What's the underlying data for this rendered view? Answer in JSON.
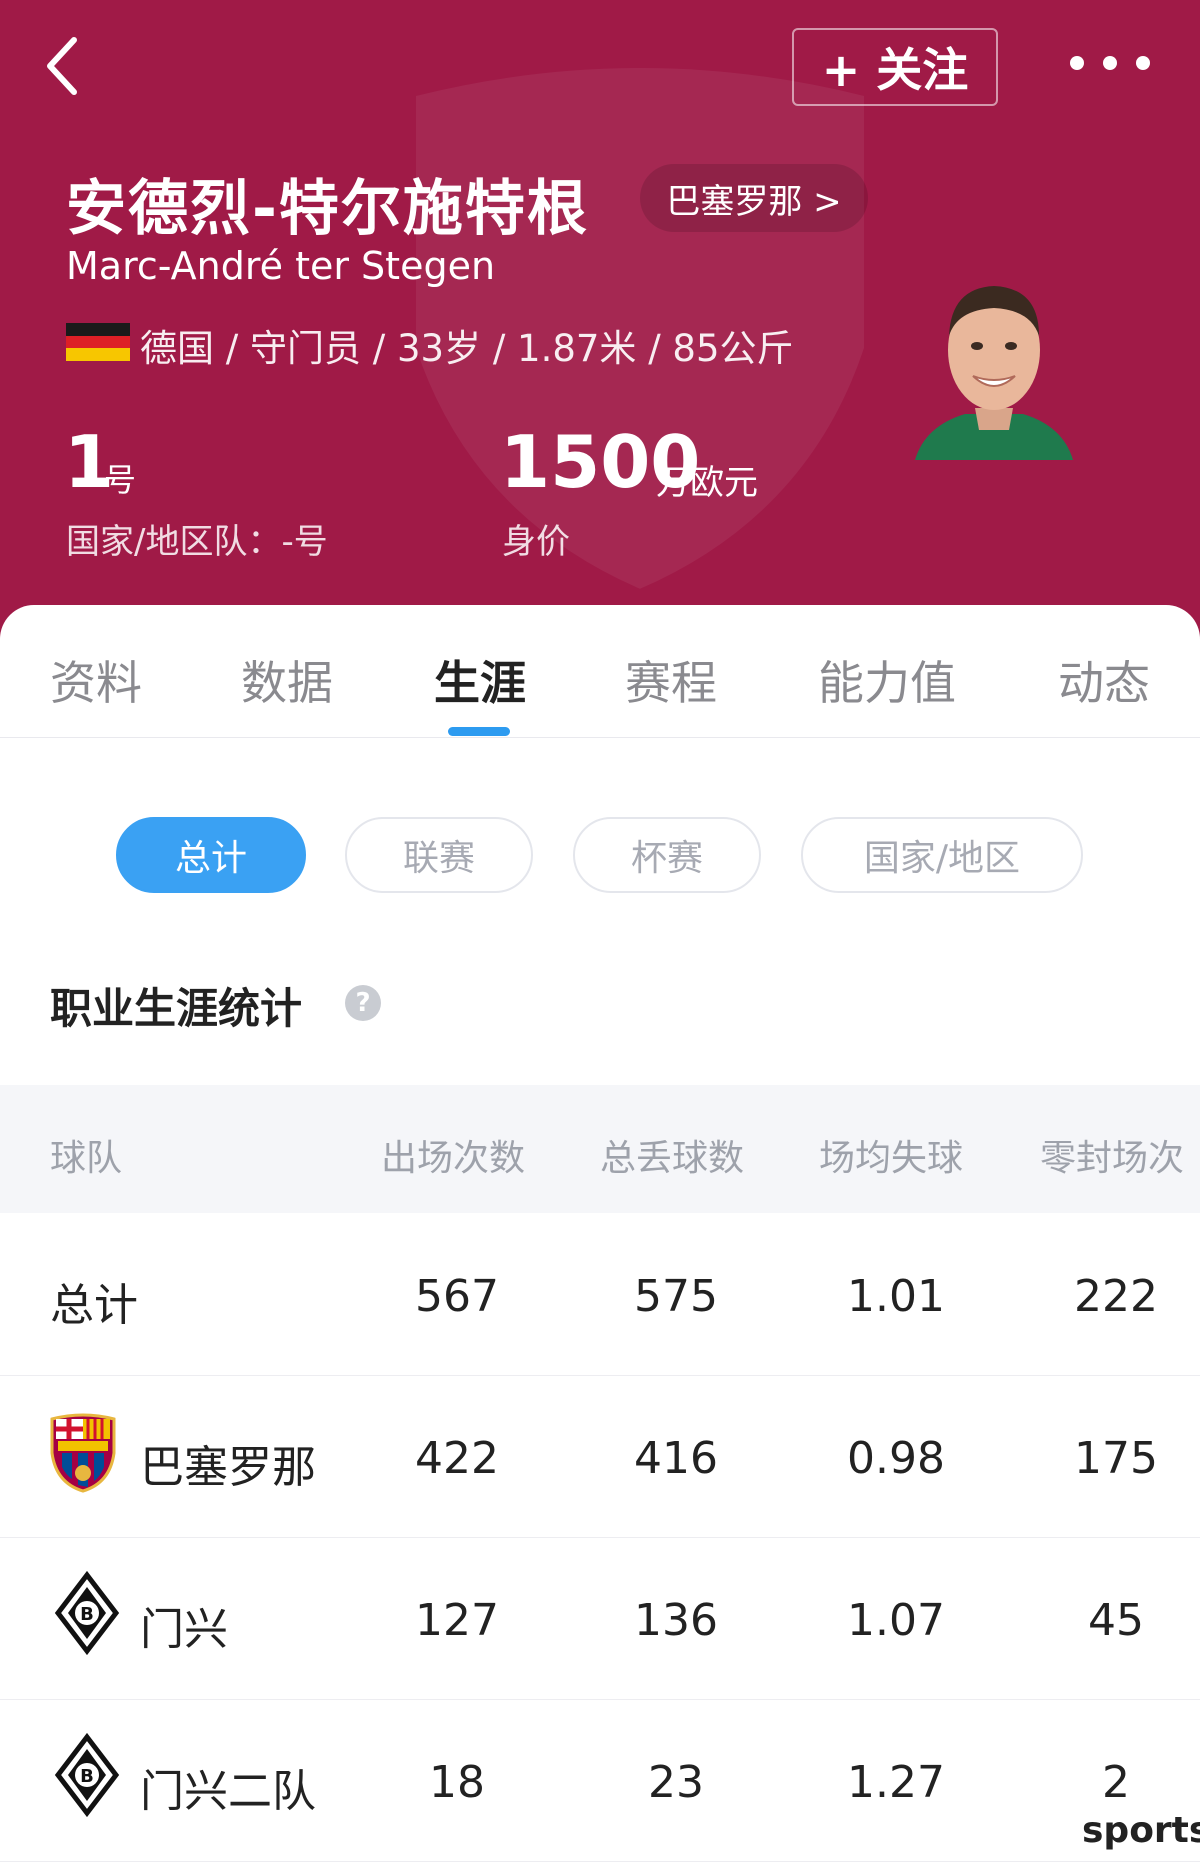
{
  "header": {
    "follow_label": "+ 关注",
    "name_zh": "安德烈-特尔施特根",
    "club_chip": "巴塞罗那 >",
    "name_en": "Marc-André ter Stegen",
    "info_line": "德国 / 守门员 / 33岁 / 1.87米 / 85公斤",
    "shirt_number": "1",
    "shirt_unit": "号",
    "national_number": "国家/地区队：-号",
    "market_value": "1500",
    "market_value_unit": "万欧元",
    "market_value_label": "身价",
    "colors": {
      "background": "#a01a47"
    }
  },
  "tabs": [
    {
      "label": "资料"
    },
    {
      "label": "数据"
    },
    {
      "label": "生涯",
      "active": true
    },
    {
      "label": "赛程"
    },
    {
      "label": "能力值"
    },
    {
      "label": "动态"
    }
  ],
  "filters": [
    {
      "label": "总计",
      "active": true
    },
    {
      "label": "联赛"
    },
    {
      "label": "杯赛"
    },
    {
      "label": "国家/地区"
    }
  ],
  "section_title": "职业生涯统计",
  "help_icon": "?",
  "table": {
    "headers": [
      "球队",
      "出场次数",
      "总丢球数",
      "场均失球",
      "零封场次"
    ],
    "rows": [
      {
        "team": "总计",
        "logo": "",
        "values": [
          "567",
          "575",
          "1.01",
          "222"
        ]
      },
      {
        "team": "巴塞罗那",
        "logo": "fcb-crest-icon",
        "values": [
          "422",
          "416",
          "0.98",
          "175"
        ]
      },
      {
        "team": "门兴",
        "logo": "borussia-mgladbach-icon",
        "values": [
          "127",
          "136",
          "1.07",
          "45"
        ]
      },
      {
        "team": "门兴二队",
        "logo": "borussia-mgladbach-icon",
        "values": [
          "18",
          "23",
          "1.27",
          "2"
        ]
      }
    ]
  },
  "watermark": "sports",
  "colors": {
    "accent": "#3aa1f3",
    "tab_underline": "#2d9bf0"
  }
}
